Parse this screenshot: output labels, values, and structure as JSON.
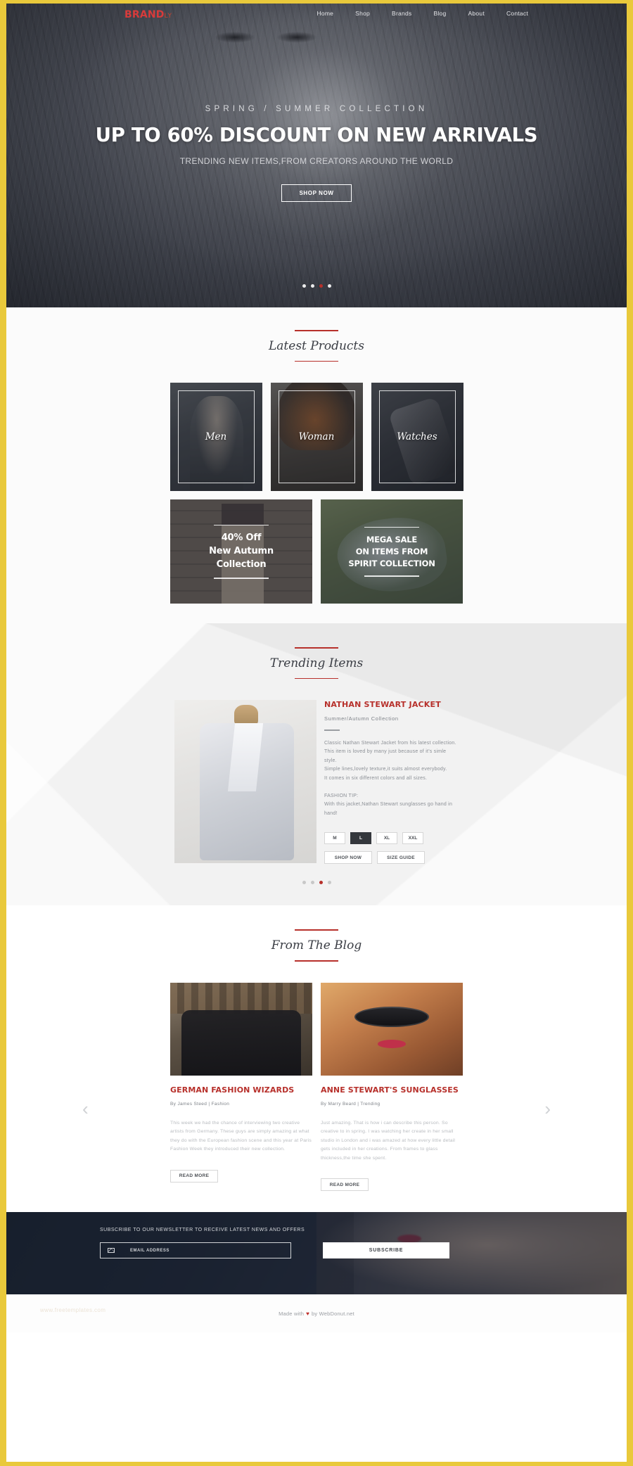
{
  "nav": {
    "brand_main": "BRAND",
    "brand_suffix": "LY",
    "items": [
      {
        "label": "Home"
      },
      {
        "label": "Shop"
      },
      {
        "label": "Brands"
      },
      {
        "label": "Blog"
      },
      {
        "label": "About"
      },
      {
        "label": "Contact"
      }
    ]
  },
  "hero": {
    "kicker": "SPRING / SUMMER COLLECTION",
    "title": "UP TO 60% DISCOUNT ON NEW ARRIVALS",
    "subtitle": "TRENDING NEW ITEMS,FROM CREATORS AROUND THE WORLD",
    "cta": "SHOP NOW",
    "slide_count": 4,
    "active_slide": 3
  },
  "latest": {
    "title": "Latest Products",
    "categories": [
      {
        "label": "Men"
      },
      {
        "label": "Woman"
      },
      {
        "label": "Watches"
      }
    ],
    "promos": [
      {
        "line1": "40% Off",
        "line2": "New Autumn",
        "line3": "Collection"
      },
      {
        "line1": "MEGA SALE",
        "line2": "ON ITEMS FROM",
        "line3": "SPIRIT COLLECTION"
      }
    ]
  },
  "trending": {
    "title": "Trending Items",
    "product": {
      "name": "NATHAN STEWART JACKET",
      "collection": "Summer/Autumn Collection",
      "description": "Classic Nathan Stewart Jacket from his latest collection.\nThis item is loved by many just because of it's simle style.\nSimple lines,lovely texture,it suits almost everybody.\nIt comes in six different colors and all sizes.",
      "tip_heading": "FASHION TIP:",
      "tip_body": "With this jacket,Nathan Stewart sunglasses go hand in hand!",
      "sizes": [
        "M",
        "L",
        "XL",
        "XXL"
      ],
      "selected_size": "L",
      "shop_now": "SHOP NOW",
      "size_guide": "SIZE GUIDE"
    },
    "slide_count": 4,
    "active_slide": 3
  },
  "blog": {
    "title": "From The Blog",
    "prev_arrow": "‹",
    "next_arrow": "›",
    "posts": [
      {
        "title": "GERMAN FASHION WIZARDS",
        "meta": "By James Steed  |  Fashion",
        "excerpt": "This week we had the chance of interviewing two creative artists from Germany. These guys are simply amazing at what they do with the European fashion scene and this year at Paris Fashion Week they introduced their new collection.",
        "read_more": "READ MORE"
      },
      {
        "title": "ANNE STEWART'S SUNGLASSES",
        "meta": "By Marry Beard  |  Trending",
        "excerpt": "Just amazing. That is how i can describe this person. So creative to in spring. I was watching her create in her small studio in London and i was amazed at how every little detail gets included in her creations. From frames to glass thickness,the time she spent.",
        "read_more": "READ MORE"
      }
    ]
  },
  "newsletter": {
    "label": "SUBSCRIBE TO OUR NEWSLETTER TO RECEIVE LATEST NEWS AND OFFERS",
    "placeholder": "EMAIL ADDRESS",
    "value": "",
    "button": "SUBSCRIBE",
    "icon": "mail-icon"
  },
  "footer": {
    "ghost_text": "www.freetemplates.com",
    "credit_prefix": "Made with",
    "heart": "♥",
    "credit_suffix": "by WebDonut.net"
  },
  "theme": {
    "accent": "#b7302b",
    "border": "#e9c93b",
    "dark": "#34373c"
  }
}
